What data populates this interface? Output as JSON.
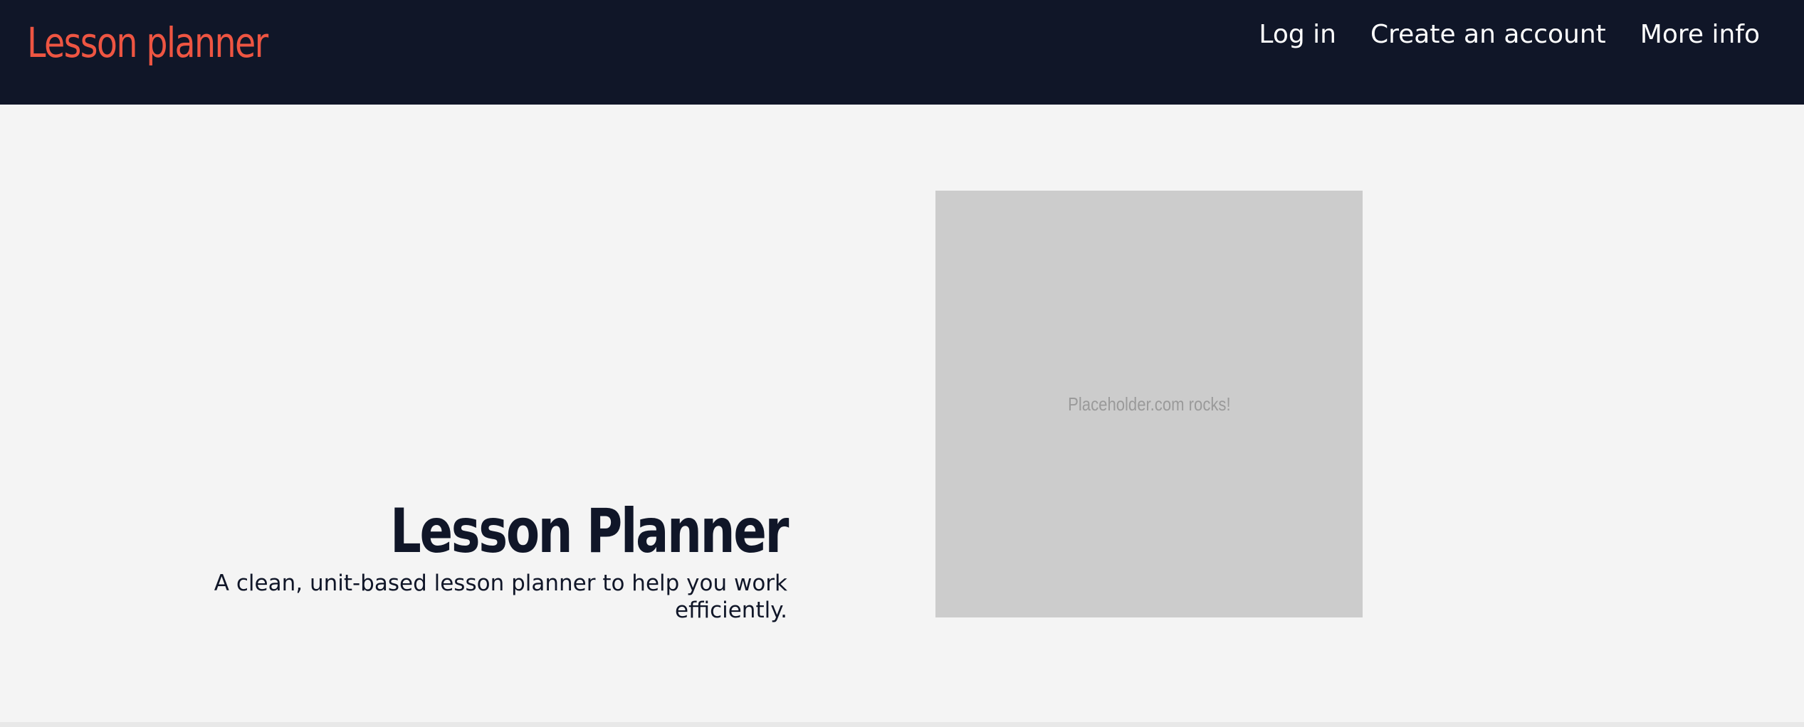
{
  "header": {
    "brand": "Lesson planner",
    "nav": [
      {
        "label": "Log in"
      },
      {
        "label": "Create an account"
      },
      {
        "label": "More info"
      }
    ]
  },
  "hero": {
    "title": "Lesson Planner",
    "subtitle": "A clean, unit-based lesson planner to help you work efficiently.",
    "image_text": "Placeholder.com rocks!"
  },
  "colors": {
    "navbar_bg": "#101628",
    "brand": "#ee5542",
    "page_bg": "#f4f4f4",
    "placeholder_bg": "#cccccc"
  }
}
